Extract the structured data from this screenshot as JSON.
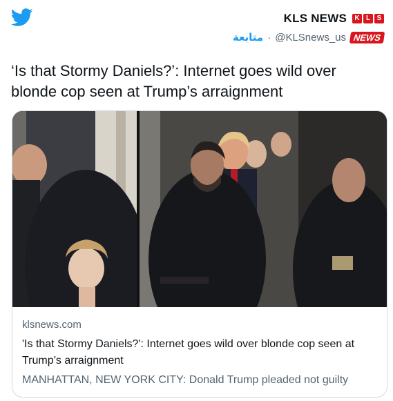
{
  "account": {
    "display_name": "KLS NEWS",
    "logo_letters": [
      "K",
      "L",
      "S"
    ],
    "follow_label": "متابعة",
    "separator": "·",
    "handle": "@KLSnews_us",
    "badge_text": "NEWS"
  },
  "tweet": {
    "text": "‘Is that Stormy Daniels?’: Internet goes wild over blonde cop seen at Trump’s arraignment"
  },
  "card": {
    "domain": "klsnews.com",
    "title": "'Is that Stormy Daniels?': Internet goes wild over blonde cop seen at Trump’s arraignment",
    "description": "MANHATTAN, NEW YORK CITY: Donald Trump pleaded not guilty"
  },
  "colors": {
    "brand_blue": "#1d9bf0",
    "kls_red": "#d8161e",
    "secondary_text": "#536471",
    "border": "#cfd9de"
  },
  "icons": {
    "logo": "twitter-bird-icon"
  }
}
